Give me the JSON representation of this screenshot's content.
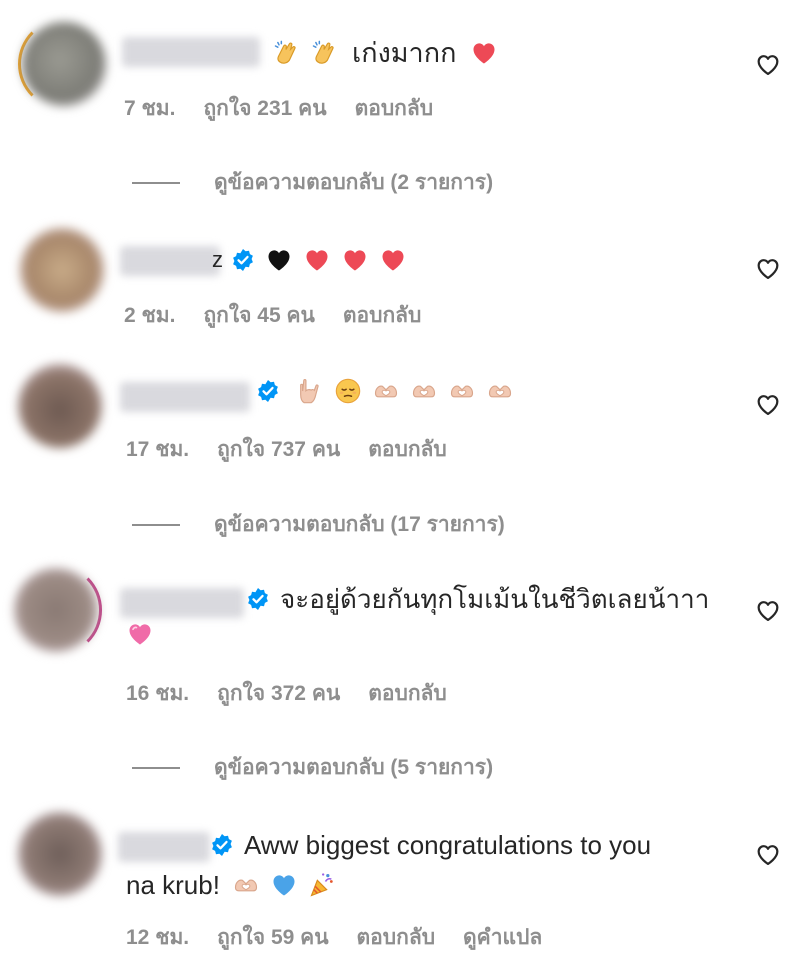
{
  "comments": [
    {
      "text": "เก่งมากก",
      "time": "7 ชม.",
      "likes": "ถูกใจ 231 คน",
      "reply": "ตอบกลับ",
      "view_replies": "ดูข้อความตอบกลับ (2 รายการ)",
      "avatar_color": "#8a8a82",
      "ring_color": "#f5a623"
    },
    {
      "text": "",
      "time": "2 ชม.",
      "likes": "ถูกใจ 45 คน",
      "reply": "ตอบกลับ",
      "avatar_color": "#b59a7c"
    },
    {
      "text": "",
      "time": "17 ชม.",
      "likes": "ถูกใจ 737 คน",
      "reply": "ตอบกลับ",
      "view_replies": "ดูข้อความตอบกลับ (17 รายการ)",
      "avatar_color": "#7d6a62"
    },
    {
      "text": "จะอยู่ด้วยกันทุกโมเม้นในชีวิตเลยน้าาา",
      "time": "16 ชม.",
      "likes": "ถูกใจ 372 คน",
      "reply": "ตอบกลับ",
      "view_replies": "ดูข้อความตอบกลับ (5 รายการ)",
      "avatar_color": "#8c7f7a",
      "ring_color": "#c13584"
    },
    {
      "text": "Aww biggest congratulations to you",
      "text_cont": "na krub!",
      "time": "12 ชม.",
      "likes": "ถูกใจ 59 คน",
      "reply": "ตอบกลับ",
      "translate": "ดูคำแปล",
      "avatar_color": "#7f6f6a"
    }
  ],
  "colors": {
    "verified": "#0095f6",
    "meta": "#8e8e8e",
    "heart": "#ed4956"
  }
}
